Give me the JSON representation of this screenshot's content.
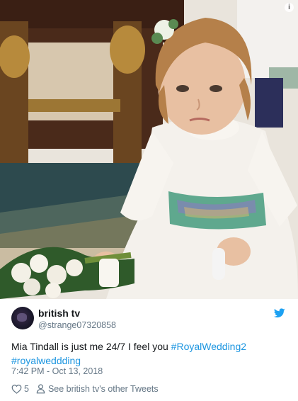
{
  "tweet": {
    "display_name": "british tv",
    "handle": "@strange07320858",
    "text_before": "Mia Tindall is just me 24/7 I feel you ",
    "hashtag1": "#RoyalWedding2",
    "hashtag2": "#royalweddding",
    "timestamp": "7:42 PM - Oct 13, 2018",
    "like_count": "5",
    "other_tweets_label": "See british tv's other Tweets"
  },
  "icons": {
    "info": "info-icon",
    "bird": "twitter-bird-icon",
    "heart": "heart-icon",
    "person": "person-icon"
  },
  "colors": {
    "link": "#1b95e0",
    "secondary_text": "#657786",
    "primary_text": "#14171a"
  }
}
